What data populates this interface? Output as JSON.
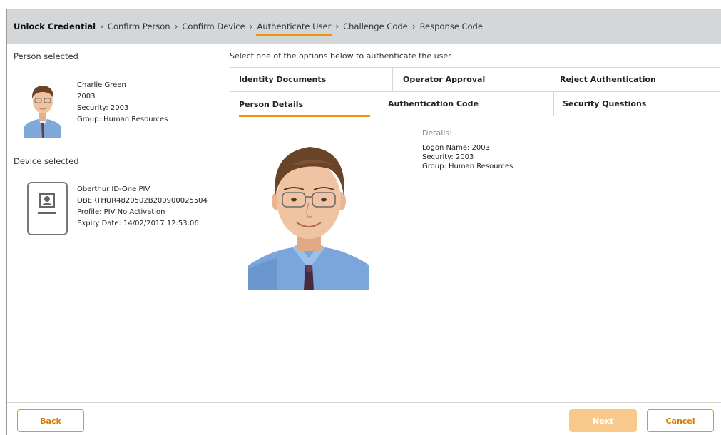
{
  "breadcrumb": {
    "steps": [
      {
        "label": "Unlock Credential"
      },
      {
        "label": "Confirm Person"
      },
      {
        "label": "Confirm Device"
      },
      {
        "label": "Authenticate User"
      },
      {
        "label": "Challenge Code"
      },
      {
        "label": "Response Code"
      }
    ],
    "active_index": 3
  },
  "person": {
    "section_title": "Person selected",
    "name": "Charlie Green",
    "id": "2003",
    "security": "Security: 2003",
    "group": "Group: Human Resources"
  },
  "device": {
    "section_title": "Device selected",
    "model": "Oberthur ID-One PIV",
    "serial": "OBERTHUR4820502B200900025504",
    "profile": "Profile: PIV No Activation",
    "expiry": "Expiry Date: 14/02/2017 12:53:06"
  },
  "main": {
    "instruction": "Select one of the options below to authenticate the user",
    "tabs_row1": [
      "Identity Documents",
      "Operator Approval",
      "Reject Authentication"
    ],
    "tabs_row2": [
      "Person Details",
      "Authentication Code",
      "Security Questions"
    ],
    "active_tab": "Person Details",
    "details": {
      "heading": "Details:",
      "logon_name": "Logon Name: 2003",
      "security": "Security: 2003",
      "group": "Group: Human Resources"
    }
  },
  "footer": {
    "back_label": "Back",
    "next_label": "Next",
    "cancel_label": "Cancel"
  },
  "colors": {
    "accent": "#f0940a",
    "header_bg": "#d4d7da",
    "next_disabled": "#f7c98a"
  }
}
